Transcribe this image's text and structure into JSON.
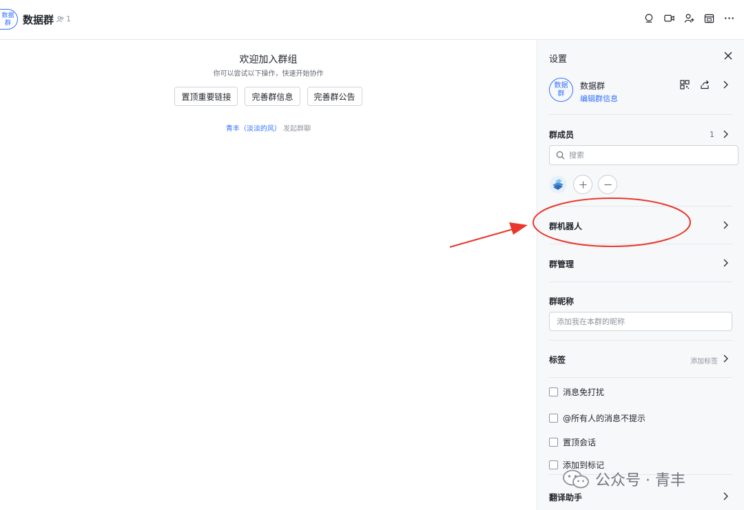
{
  "header": {
    "avatar_text": "数据\n群",
    "title": "数据群",
    "member_count": "1",
    "icons": [
      "search-chat-icon",
      "video-call-icon",
      "add-member-icon",
      "calendar-icon",
      "more-icon"
    ]
  },
  "main": {
    "welcome_title": "欢迎加入群组",
    "welcome_subtitle": "你可以尝试以下操作，快速开始协作",
    "actions": [
      "置顶重要链接",
      "完善群信息",
      "完善群公告"
    ],
    "system_user": "青丰（淡淡的风）",
    "system_action": "发起群聊"
  },
  "settings": {
    "title": "设置",
    "group_avatar_text": "数据\n群",
    "group_name": "数据群",
    "edit_info": "编辑群信息",
    "members_label": "群成员",
    "members_count": "1",
    "search_placeholder": "搜索",
    "bots_label": "群机器人",
    "manage_label": "群管理",
    "nickname_label": "群昵称",
    "nickname_placeholder": "添加我在本群的昵称",
    "tags_label": "标签",
    "tags_add": "添加标签",
    "options": [
      {
        "label": "消息免打扰",
        "checked": false
      },
      {
        "label": "@所有人的消息不提示",
        "checked": false
      },
      {
        "label": "置顶会话",
        "checked": false
      },
      {
        "label": "添加到标记",
        "checked": false
      }
    ],
    "translate_label": "翻译助手"
  },
  "watermark": {
    "text": "公众号 · 青丰"
  },
  "colors": {
    "accent": "#3370ff",
    "annotation": "#e8372c",
    "panel_bg": "#f7f8fa"
  }
}
